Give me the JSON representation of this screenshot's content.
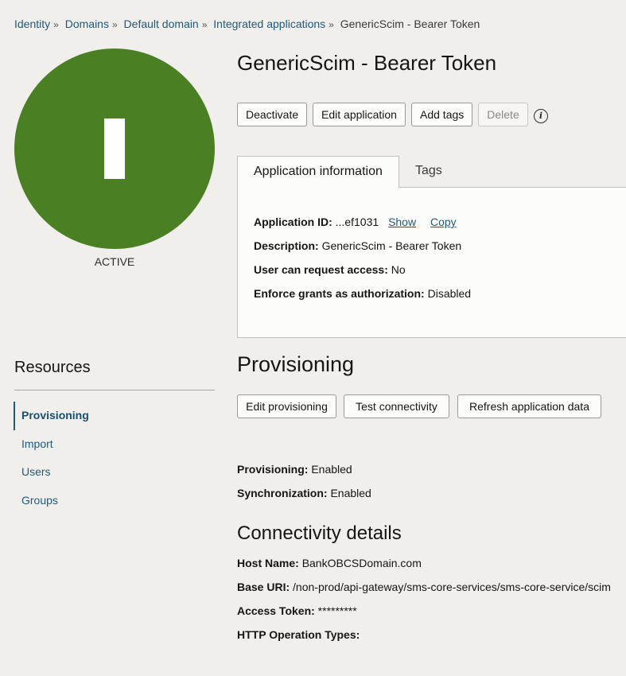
{
  "breadcrumb": {
    "items": [
      "Identity",
      "Domains",
      "Default domain",
      "Integrated applications"
    ],
    "separator": "»",
    "current": "GenericScim - Bearer Token"
  },
  "avatar": {
    "letter": "I",
    "color": "#4b7f23",
    "status": "ACTIVE"
  },
  "page_title": "GenericScim - Bearer Token",
  "actions": {
    "deactivate": "Deactivate",
    "edit_application": "Edit application",
    "add_tags": "Add tags",
    "delete": "Delete",
    "info_icon": "i"
  },
  "tabs": {
    "active": "Application information",
    "other": "Tags"
  },
  "app_info": {
    "app_id_label": "Application ID:",
    "app_id_value": "...ef1031",
    "show_link": "Show",
    "copy_link": "Copy",
    "description_label": "Description:",
    "description_value": "GenericScim - Bearer Token",
    "request_access_label": "User can request access:",
    "request_access_value": "No",
    "enforce_grants_label": "Enforce grants as authorization:",
    "enforce_grants_value": "Disabled"
  },
  "resources": {
    "title": "Resources",
    "items": [
      "Provisioning",
      "Import",
      "Users",
      "Groups"
    ]
  },
  "provisioning": {
    "title": "Provisioning",
    "edit_button": "Edit provisioning",
    "test_button": "Test connectivity",
    "refresh_button": "Refresh application data",
    "provisioning_label": "Provisioning:",
    "provisioning_value": "Enabled",
    "sync_label": "Synchronization:",
    "sync_value": "Enabled"
  },
  "connectivity": {
    "title": "Connectivity details",
    "host_label": "Host Name:",
    "host_value": "BankOBCSDomain.com",
    "base_uri_label": "Base URI:",
    "base_uri_value": "/non-prod/api-gateway/sms-core-services/sms-core-service/scim",
    "token_label": "Access Token:",
    "token_value": "*********",
    "http_label": "HTTP Operation Types:"
  }
}
